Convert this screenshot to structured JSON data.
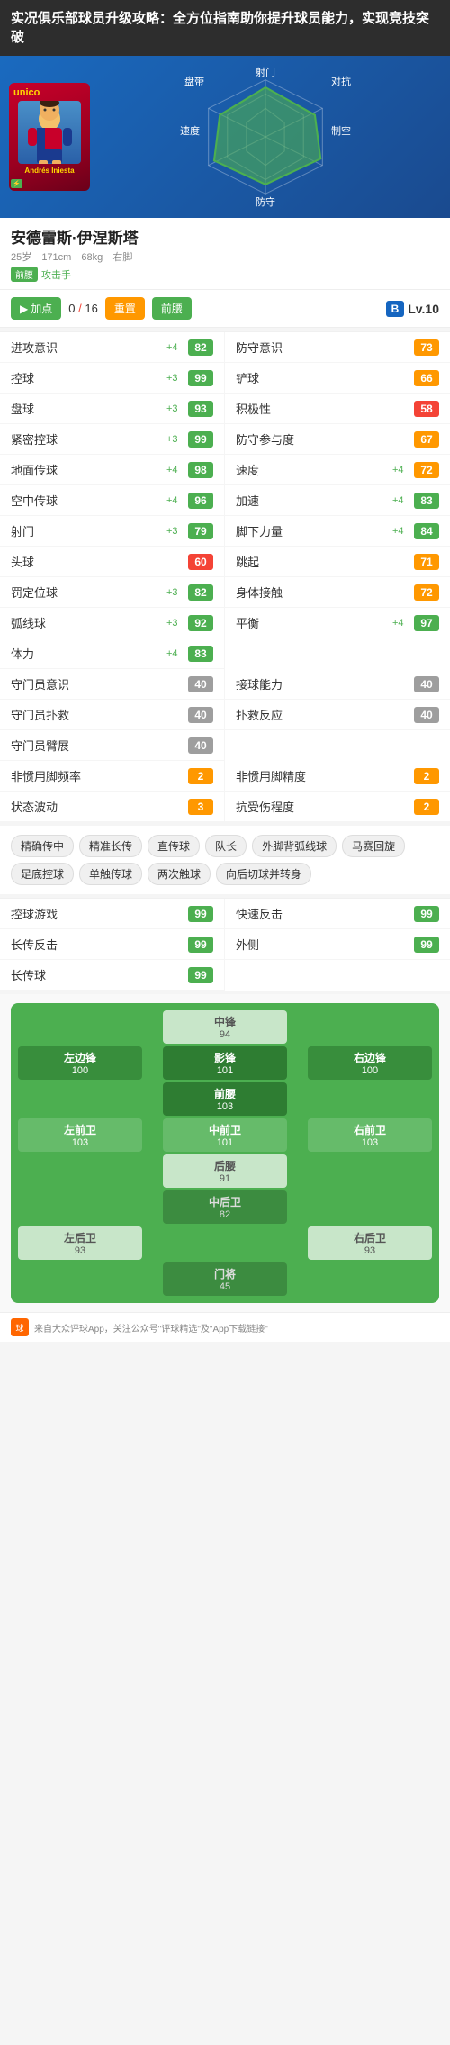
{
  "pageTitle": "实况俱乐部球员升级攻略：全方位指南助你提升球员能力，实现竞技突破",
  "player": {
    "name": "安德雷斯·伊涅斯塔",
    "age": "25岁",
    "height": "171cm",
    "weight": "68kg",
    "foot": "右脚",
    "position": "前腰",
    "positionType": "攻击手",
    "rating": "B",
    "level": "Lv.10"
  },
  "addPoints": {
    "label": "加点",
    "current": "0",
    "total": "16",
    "resetLabel": "重置",
    "positionLabel": "前腰",
    "addArrow": "▶"
  },
  "radar": {
    "labels": {
      "shoot": "射门",
      "dribble": "盘带",
      "oppose": "对抗",
      "speed": "速度",
      "control": "制空",
      "defense": "防守"
    }
  },
  "stats": [
    {
      "name": "进攻意识",
      "delta": "+4",
      "value": "82",
      "color": "green"
    },
    {
      "name": "防守意识",
      "delta": "",
      "value": "73",
      "color": "orange"
    },
    {
      "name": "控球",
      "delta": "+3",
      "value": "99",
      "color": "green"
    },
    {
      "name": "铲球",
      "delta": "",
      "value": "66",
      "color": "orange"
    },
    {
      "name": "盘球",
      "delta": "+3",
      "value": "93",
      "color": "green"
    },
    {
      "name": "积极性",
      "delta": "",
      "value": "58",
      "color": "red"
    },
    {
      "name": "紧密控球",
      "delta": "+3",
      "value": "99",
      "color": "green"
    },
    {
      "name": "防守参与度",
      "delta": "",
      "value": "67",
      "color": "orange"
    },
    {
      "name": "地面传球",
      "delta": "+4",
      "value": "98",
      "color": "green"
    },
    {
      "name": "速度",
      "delta": "+4",
      "value": "72",
      "color": "orange"
    },
    {
      "name": "空中传球",
      "delta": "+4",
      "value": "96",
      "color": "green"
    },
    {
      "name": "加速",
      "delta": "+4",
      "value": "83",
      "color": "green"
    },
    {
      "name": "射门",
      "delta": "+3",
      "value": "79",
      "color": "green"
    },
    {
      "name": "脚下力量",
      "delta": "+4",
      "value": "84",
      "color": "green"
    },
    {
      "name": "头球",
      "delta": "",
      "value": "60",
      "color": "red"
    },
    {
      "name": "跳起",
      "delta": "",
      "value": "71",
      "color": "orange"
    },
    {
      "name": "罚定位球",
      "delta": "+3",
      "value": "82",
      "color": "green"
    },
    {
      "name": "身体接触",
      "delta": "",
      "value": "72",
      "color": "orange"
    },
    {
      "name": "弧线球",
      "delta": "+3",
      "value": "92",
      "color": "green"
    },
    {
      "name": "平衡",
      "delta": "+4",
      "value": "97",
      "color": "green"
    },
    {
      "name": "体力",
      "delta": "+4",
      "value": "83",
      "color": "green"
    },
    {
      "name": "",
      "delta": "",
      "value": "",
      "color": ""
    },
    {
      "name": "守门员意识",
      "delta": "",
      "value": "40",
      "color": "gray"
    },
    {
      "name": "接球能力",
      "delta": "",
      "value": "40",
      "color": "gray"
    },
    {
      "name": "守门员扑救",
      "delta": "",
      "value": "40",
      "color": "gray"
    },
    {
      "name": "扑救反应",
      "delta": "",
      "value": "40",
      "color": "gray"
    },
    {
      "name": "守门员臂展",
      "delta": "",
      "value": "40",
      "color": "gray"
    },
    {
      "name": "",
      "delta": "",
      "value": "",
      "color": ""
    },
    {
      "name": "非惯用脚频率",
      "delta": "",
      "value": "2",
      "color": "orange"
    },
    {
      "name": "非惯用脚精度",
      "delta": "",
      "value": "2",
      "color": "orange"
    },
    {
      "name": "状态波动",
      "delta": "",
      "value": "3",
      "color": "orange"
    },
    {
      "name": "抗受伤程度",
      "delta": "",
      "value": "2",
      "color": "orange"
    }
  ],
  "skills": {
    "title": "",
    "tags": [
      "精确传中",
      "精准长传",
      "直传球",
      "队长",
      "外脚背弧线球",
      "马赛回旋",
      "足底控球",
      "单触传球",
      "两次触球",
      "向后切球并转身"
    ]
  },
  "playStyles": [
    {
      "name": "控球游戏",
      "value": "99",
      "color": "green"
    },
    {
      "name": "快速反击",
      "value": "99",
      "color": "green"
    },
    {
      "name": "长传反击",
      "value": "99",
      "color": "green"
    },
    {
      "name": "外侧",
      "value": "99",
      "color": "green"
    },
    {
      "name": "长传球",
      "value": "99",
      "color": "green"
    }
  ],
  "positions": {
    "rows": [
      {
        "items": [
          {
            "name": "",
            "score": "",
            "type": "empty"
          },
          {
            "name": "中锋",
            "score": "94",
            "type": "dim"
          },
          {
            "name": "",
            "score": "",
            "type": "empty"
          }
        ]
      },
      {
        "items": [
          {
            "name": "左边锋",
            "score": "100",
            "type": "bright"
          },
          {
            "name": "影锋",
            "score": "101",
            "type": "highlight"
          },
          {
            "name": "右边锋",
            "score": "100",
            "type": "bright"
          }
        ]
      },
      {
        "items": [
          {
            "name": "",
            "score": "",
            "type": "empty"
          },
          {
            "name": "前腰",
            "score": "103",
            "type": "highlight"
          },
          {
            "name": "",
            "score": "",
            "type": "empty"
          }
        ]
      },
      {
        "items": [
          {
            "name": "左前卫",
            "score": "103",
            "type": "mid"
          },
          {
            "name": "中前卫",
            "score": "101",
            "type": "mid"
          },
          {
            "name": "右前卫",
            "score": "103",
            "type": "mid"
          }
        ]
      },
      {
        "items": [
          {
            "name": "",
            "score": "",
            "type": "empty"
          },
          {
            "name": "后腰",
            "score": "91",
            "type": "dim"
          },
          {
            "name": "",
            "score": "",
            "type": "empty"
          }
        ]
      },
      {
        "items": [
          {
            "name": "",
            "score": "",
            "type": "empty"
          },
          {
            "name": "中后卫",
            "score": "82",
            "type": "gray"
          },
          {
            "name": "",
            "score": "",
            "type": "empty"
          }
        ]
      },
      {
        "items": [
          {
            "name": "左后卫",
            "score": "93",
            "type": "dim"
          },
          {
            "name": "",
            "score": "",
            "type": "empty"
          },
          {
            "name": "右后卫",
            "score": "93",
            "type": "dim"
          }
        ]
      },
      {
        "items": [
          {
            "name": "",
            "score": "",
            "type": "empty"
          },
          {
            "name": "门将",
            "score": "45",
            "type": "gray"
          },
          {
            "name": "",
            "score": "",
            "type": "empty"
          }
        ]
      }
    ]
  },
  "footer": {
    "text": "来自大众评球App，关注公众号\"评球精选\"及\"App下载链接\""
  }
}
